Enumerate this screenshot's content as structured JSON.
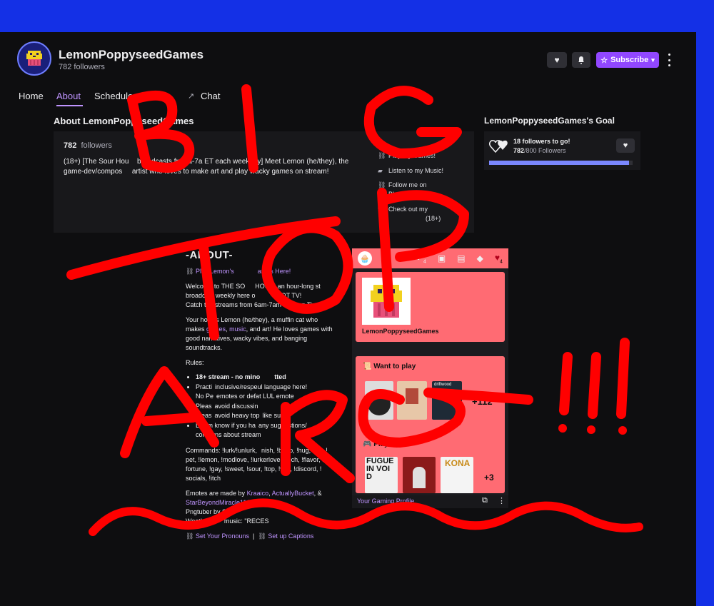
{
  "channel": {
    "name": "LemonPoppyseedGames",
    "followers": "782 followers"
  },
  "header": {
    "subscribe_label": "Subscribe"
  },
  "nav": {
    "home": "Home",
    "about": "About",
    "schedule": "Schedule",
    "videos": "Vi",
    "chat": "Chat"
  },
  "about": {
    "title": "About LemonPoppyseedGames",
    "count": "782",
    "count_label": "followers",
    "description_1": "(18+) [The Sour Hou",
    "description_2": "broadcasts fr",
    "description_3": "a-7a ET each weekday] Meet Lemon (he/they), the",
    "description_4": "game-dev/compos",
    "description_5": "artist who loves to make art and play wacky games on stream!",
    "links": [
      {
        "label": "Play My Games!",
        "icon": "link-icon"
      },
      {
        "label": "Listen to my Music!",
        "icon": "bandcamp-icon"
      },
      {
        "label": "Follow me on",
        "label2": "Bluesky! (18+)",
        "icon": "link-icon"
      },
      {
        "label": "Check out my",
        "label2": "(18+)",
        "icon": "tumblr-icon"
      }
    ]
  },
  "goal": {
    "title": "LemonPoppyseedGames's Goal",
    "main": "18 followers to go!",
    "current": "782",
    "total": "/800 Followers",
    "progress": 0.9775
  },
  "panel": {
    "title": "-ABOUT-",
    "play_link": "Play Lemon's",
    "play_link_end": "ames Here!",
    "welcome_1": "Welcome to THE SO",
    "welcome_2": "HOUR, an hour-long st",
    "welcome_3": "broadcast weekly here o",
    "welcome_4": "QT TV!",
    "welcome_5": "Catch the streams from 6am-7am Eastern Time!",
    "host_1": "Your host is Lemon (he/they), a muffin cat who",
    "host_2": "makes",
    "host_games": "games",
    "host_music": "music",
    "host_3": ", and art! He loves games with",
    "host_4": "good narratives, wacky vibes, and banging",
    "host_5": "soundtracks.",
    "rules_label": "Rules:",
    "rules": [
      "18+ stream - no mino",
      "Practi",
      "No Pe",
      "Pleas",
      "Pleas",
      "Let"
    ],
    "rules_tail": [
      "tted",
      "inclusive/respe",
      "emotes or defa",
      "avoid discussin",
      "avoid heavy top",
      "m know if you ha"
    ],
    "rules_tail2": [
      "",
      "ul language here!",
      "t LUL emote",
      "",
      "like suici",
      "any suggestions/"
    ],
    "rules_extra": "concerns about stream",
    "commands_1": "Commands: !lurk/!unlurk,",
    "commands_1b": "nish, !boop, !hug, !jail, !",
    "commands_2": "pet, !lemon, !modlove, !lurkerlove, !tech, !flavor, !",
    "commands_3": "fortune, !gay, !sweet, !sour, !top, !war, !discord, !",
    "commands_4": "socials, !itch",
    "emotes_1": "Emotes are made by",
    "artist_1": "Kraaico",
    "artist_2": "ActuallyBucket",
    "artist_3": "StarBeyondMiracle1161",
    "pngtuber": "Pngtuber by S",
    "weather": "Weath",
    "weather_2": "music: \"RECES",
    "pronouns": "Set Your Pronouns",
    "captions": "Set up Captions"
  },
  "extension": {
    "profile_name": "LemonPoppyseedGames",
    "want_to_play": "Want to play",
    "want_more": "+112",
    "playing": "Playing",
    "playing_more": "+3",
    "thumb_driftwood": "driftwood",
    "thumb_kona": "KONA",
    "thumb_fugue": "FUGUE IN VOID",
    "footer": "Your Gaming Profile",
    "tab_badges": [
      "4",
      "4"
    ]
  },
  "scribble": {
    "line1": "BIG",
    "line2": "TOP",
    "line3": "ARG!!!",
    "color": "#ff0000"
  },
  "colors": {
    "accent": "#9147ff",
    "link": "#bf94ff",
    "ext_pink": "#ff6b73",
    "frame_blue": "#1430e6"
  }
}
